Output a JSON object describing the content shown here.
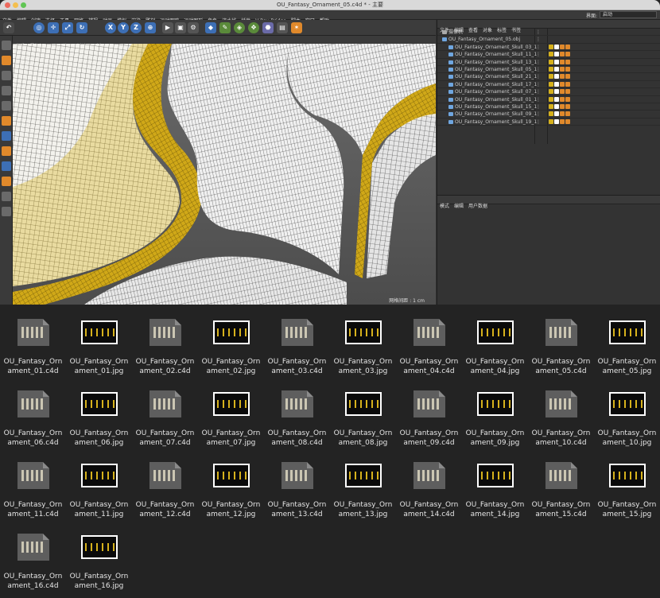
{
  "window": {
    "title": "OU_Fantasy_Ornament_05.c4d * - 主要"
  },
  "menubar": {
    "items": [
      "文件",
      "编辑",
      "创建",
      "选择",
      "工具",
      "网格",
      "捕捉",
      "动画",
      "模拟",
      "渲染",
      "雕刻",
      "运动跟踪",
      "运动图形",
      "角色",
      "流水线",
      "插件",
      "V-Ray Bridge",
      "脚本",
      "窗口",
      "帮助"
    ],
    "layout_label": "界面:",
    "layout_value": "启动"
  },
  "toolbar": {
    "icons": [
      "undo-icon",
      "live-select-icon",
      "move-icon",
      "scale-icon",
      "rotate-icon",
      "x-axis-icon",
      "y-axis-icon",
      "z-axis-icon",
      "world-coord-icon",
      "render-view-icon",
      "render-picture-viewer-icon",
      "edit-render-settings-icon",
      "cube-icon",
      "pen-icon",
      "subdivision-icon",
      "array-icon",
      "deformer-icon",
      "camera-icon",
      "light-icon"
    ],
    "axis_labels": [
      "X",
      "Y",
      "Z"
    ]
  },
  "viewport": {
    "menu": [
      "查看",
      "摄像机",
      "显示",
      "选项",
      "过滤",
      "面板",
      "ProRender"
    ],
    "grid_label": "网格间距 : 1 cm"
  },
  "object_manager": {
    "menu": [
      "文件",
      "编辑",
      "查看",
      "对象",
      "标签",
      "书签"
    ],
    "items": [
      {
        "name": "摄像机"
      },
      {
        "name": "OU_Fantasy_Ornament_05.obj"
      },
      {
        "name": "OU_Fantasy_Ornament_Skull_03_1"
      },
      {
        "name": "OU_Fantasy_Ornament_Skull_11_1"
      },
      {
        "name": "OU_Fantasy_Ornament_Skull_13_1"
      },
      {
        "name": "OU_Fantasy_Ornament_Skull_05_1"
      },
      {
        "name": "OU_Fantasy_Ornament_Skull_21_1"
      },
      {
        "name": "OU_Fantasy_Ornament_Skull_17_1"
      },
      {
        "name": "OU_Fantasy_Ornament_Skull_07_1"
      },
      {
        "name": "OU_Fantasy_Ornament_Skull_01_1"
      },
      {
        "name": "OU_Fantasy_Ornament_Skull_15_1"
      },
      {
        "name": "OU_Fantasy_Ornament_Skull_09_1"
      },
      {
        "name": "OU_Fantasy_Ornament_Skull_19_1"
      }
    ]
  },
  "attribute_manager": {
    "menu": [
      "模式",
      "编辑",
      "用户数据"
    ]
  },
  "files": [
    {
      "line1": "OU_Fantasy_Orn",
      "line2": "ament_01.c4d",
      "kind": "c4d"
    },
    {
      "line1": "OU_Fantasy_Orn",
      "line2": "ament_01.jpg",
      "kind": "jpg"
    },
    {
      "line1": "OU_Fantasy_Orn",
      "line2": "ament_02.c4d",
      "kind": "c4d"
    },
    {
      "line1": "OU_Fantasy_Orn",
      "line2": "ament_02.jpg",
      "kind": "jpg"
    },
    {
      "line1": "OU_Fantasy_Orn",
      "line2": "ament_03.c4d",
      "kind": "c4d"
    },
    {
      "line1": "OU_Fantasy_Orn",
      "line2": "ament_03.jpg",
      "kind": "jpg"
    },
    {
      "line1": "OU_Fantasy_Orn",
      "line2": "ament_04.c4d",
      "kind": "c4d"
    },
    {
      "line1": "OU_Fantasy_Orn",
      "line2": "ament_04.jpg",
      "kind": "jpg"
    },
    {
      "line1": "OU_Fantasy_Orn",
      "line2": "ament_05.c4d",
      "kind": "c4d"
    },
    {
      "line1": "OU_Fantasy_Orn",
      "line2": "ament_05.jpg",
      "kind": "jpg"
    },
    {
      "line1": "OU_Fantasy_Orn",
      "line2": "ament_06.c4d",
      "kind": "c4d"
    },
    {
      "line1": "OU_Fantasy_Orn",
      "line2": "ament_06.jpg",
      "kind": "jpg"
    },
    {
      "line1": "OU_Fantasy_Orn",
      "line2": "ament_07.c4d",
      "kind": "c4d"
    },
    {
      "line1": "OU_Fantasy_Orn",
      "line2": "ament_07.jpg",
      "kind": "jpg"
    },
    {
      "line1": "OU_Fantasy_Orn",
      "line2": "ament_08.c4d",
      "kind": "c4d"
    },
    {
      "line1": "OU_Fantasy_Orn",
      "line2": "ament_08.jpg",
      "kind": "jpg"
    },
    {
      "line1": "OU_Fantasy_Orn",
      "line2": "ament_09.c4d",
      "kind": "c4d"
    },
    {
      "line1": "OU_Fantasy_Orn",
      "line2": "ament_09.jpg",
      "kind": "jpg"
    },
    {
      "line1": "OU_Fantasy_Orn",
      "line2": "ament_10.c4d",
      "kind": "c4d"
    },
    {
      "line1": "OU_Fantasy_Orn",
      "line2": "ament_10.jpg",
      "kind": "jpg"
    },
    {
      "line1": "OU_Fantasy_Orn",
      "line2": "ament_11.c4d",
      "kind": "c4d"
    },
    {
      "line1": "OU_Fantasy_Orn",
      "line2": "ament_11.jpg",
      "kind": "jpg"
    },
    {
      "line1": "OU_Fantasy_Orn",
      "line2": "ament_12.c4d",
      "kind": "c4d"
    },
    {
      "line1": "OU_Fantasy_Orn",
      "line2": "ament_12.jpg",
      "kind": "jpg"
    },
    {
      "line1": "OU_Fantasy_Orn",
      "line2": "ament_13.c4d",
      "kind": "c4d"
    },
    {
      "line1": "OU_Fantasy_Orn",
      "line2": "ament_13.jpg",
      "kind": "jpg"
    },
    {
      "line1": "OU_Fantasy_Orn",
      "line2": "ament_14.c4d",
      "kind": "c4d"
    },
    {
      "line1": "OU_Fantasy_Orn",
      "line2": "ament_14.jpg",
      "kind": "jpg"
    },
    {
      "line1": "OU_Fantasy_Orn",
      "line2": "ament_15.c4d",
      "kind": "c4d"
    },
    {
      "line1": "OU_Fantasy_Orn",
      "line2": "ament_15.jpg",
      "kind": "jpg"
    },
    {
      "line1": "OU_Fantasy_Orn",
      "line2": "ament_16.c4d",
      "kind": "c4d"
    },
    {
      "line1": "OU_Fantasy_Orn",
      "line2": "ament_16.jpg",
      "kind": "jpg"
    }
  ],
  "colors": {
    "gold": "#d6b11c",
    "mesh_base": "#e9dba0",
    "wire": "#2a2a2a",
    "accent_blue": "#3d6fb5",
    "orange_tag": "#e0892b"
  }
}
